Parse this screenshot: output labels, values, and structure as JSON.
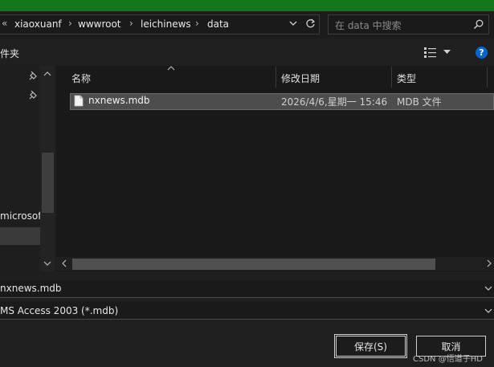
{
  "address": {
    "overflow_label": "«",
    "crumbs": [
      "xiaoxuanf",
      "wwwroot",
      "leichinews",
      "data"
    ],
    "separator": "›"
  },
  "search": {
    "placeholder": "在 data 中搜索"
  },
  "toolbar": {
    "left_label": "件夹",
    "help_label": "?"
  },
  "sidebar": {
    "item_label": "microsoft"
  },
  "columns": {
    "name": "名称",
    "modified": "修改日期",
    "type": "类型"
  },
  "files": [
    {
      "name": "nxnews.mdb",
      "modified": "2026/4/6,星期一 15:46",
      "type": "MDB 文件"
    }
  ],
  "filename_field": {
    "value": "nxnews.mdb"
  },
  "filetype_field": {
    "value": "MS Access 2003 (*.mdb)"
  },
  "buttons": {
    "save": "保存(S)",
    "cancel": "取消"
  },
  "watermark": "CSDN @悟道子HD",
  "colors": {
    "titlebar": "#12781a",
    "background": "#191919",
    "selected_row": "#4d4d4d",
    "help": "#0a66cc"
  }
}
